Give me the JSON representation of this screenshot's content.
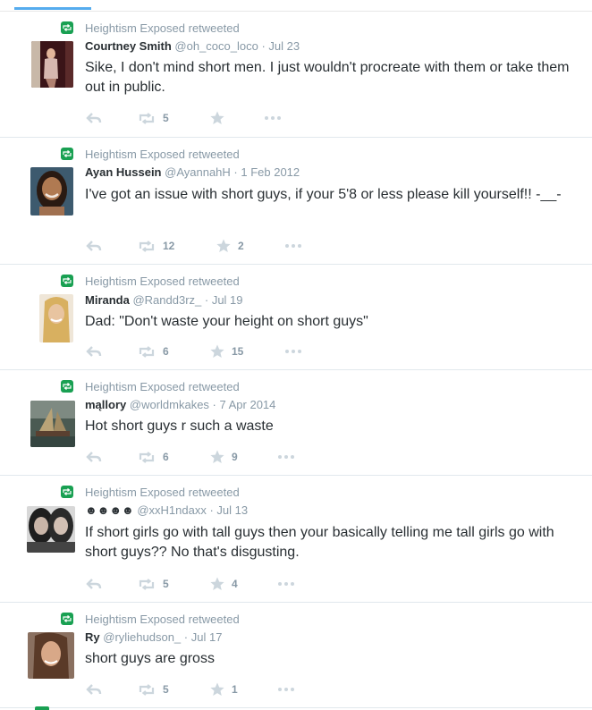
{
  "retweet_label": "Heightism Exposed retweeted",
  "icons": {
    "retweet_badge": "retweet-badge-icon",
    "reply": "reply-icon",
    "retweet": "retweet-icon",
    "favorite": "star-icon",
    "more": "more-icon"
  },
  "colors": {
    "accent": "#55acee",
    "retweet_green": "#19a052",
    "muted": "#8899a6",
    "text": "#292f33"
  },
  "tweets": [
    {
      "name": "Courtney Smith",
      "handle": "@oh_coco_loco",
      "sep": " · ",
      "date": "Jul 23",
      "text": "Sike, I don't mind short men. I just wouldn't procreate with them or take them out in public.",
      "retweets": "5",
      "favorites": ""
    },
    {
      "name": "Ayan Hussein",
      "handle": "@AyannahH",
      "sep": " · ",
      "date": "1 Feb 2012",
      "text": "I've got an issue with short guys, if your 5'8 or less please kill yourself!! -__-",
      "retweets": "12",
      "favorites": "2"
    },
    {
      "name": "Miranda",
      "handle": "@Randd3rz_",
      "sep": " · ",
      "date": "Jul 19",
      "text": "Dad: \"Don't waste your height on short guys\"",
      "retweets": "6",
      "favorites": "15"
    },
    {
      "name": "mąllory",
      "handle": "@worldmkakes",
      "sep": " · ",
      "date": "7 Apr 2014",
      "text": "Hot short guys r such a waste",
      "retweets": "6",
      "favorites": "9"
    },
    {
      "name": "☻☻☻☻",
      "handle": "@xxH1ndaxx",
      "sep": " · ",
      "date": "Jul 13",
      "text": "If short girls go with tall guys then your basically telling me tall girls go with short guys?? No that's disgusting.",
      "retweets": "5",
      "favorites": "4"
    },
    {
      "name": "Ry",
      "handle": "@ryliehudson_",
      "sep": " · ",
      "date": "Jul 17",
      "text": "short guys are gross",
      "retweets": "5",
      "favorites": "1"
    }
  ]
}
